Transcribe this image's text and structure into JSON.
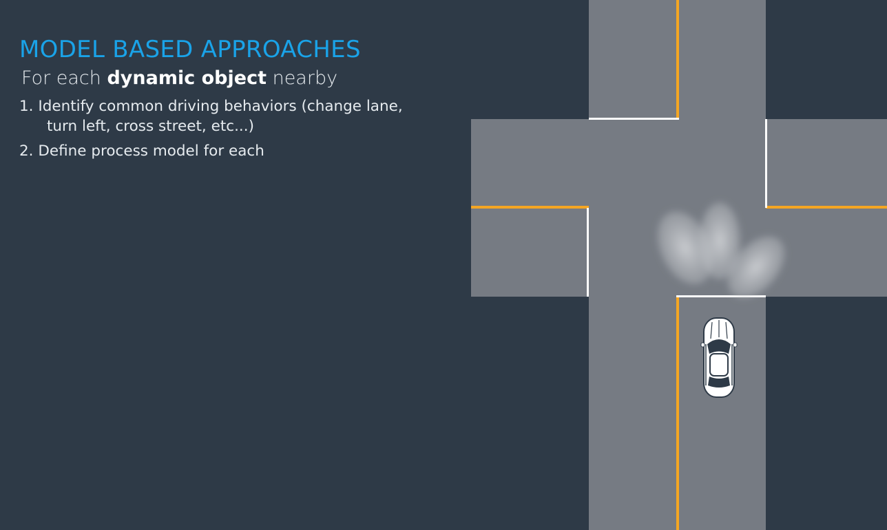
{
  "slide": {
    "title": "MODEL BASED APPROACHES",
    "subtitle": {
      "prefix": "For each ",
      "bold": "dynamic object",
      "suffix": " nearby"
    },
    "steps": [
      {
        "line1": "1. Identify common driving behaviors (change lane,",
        "line2": "turn left, cross street, etc...)"
      },
      {
        "line1": "2. Define process model for each"
      }
    ]
  },
  "colors": {
    "background": "#2e3a47",
    "title": "#1aa3e8",
    "road": "#767b83",
    "lane_marking_yellow": "#f5a623",
    "stop_line_white": "#ffffff"
  }
}
